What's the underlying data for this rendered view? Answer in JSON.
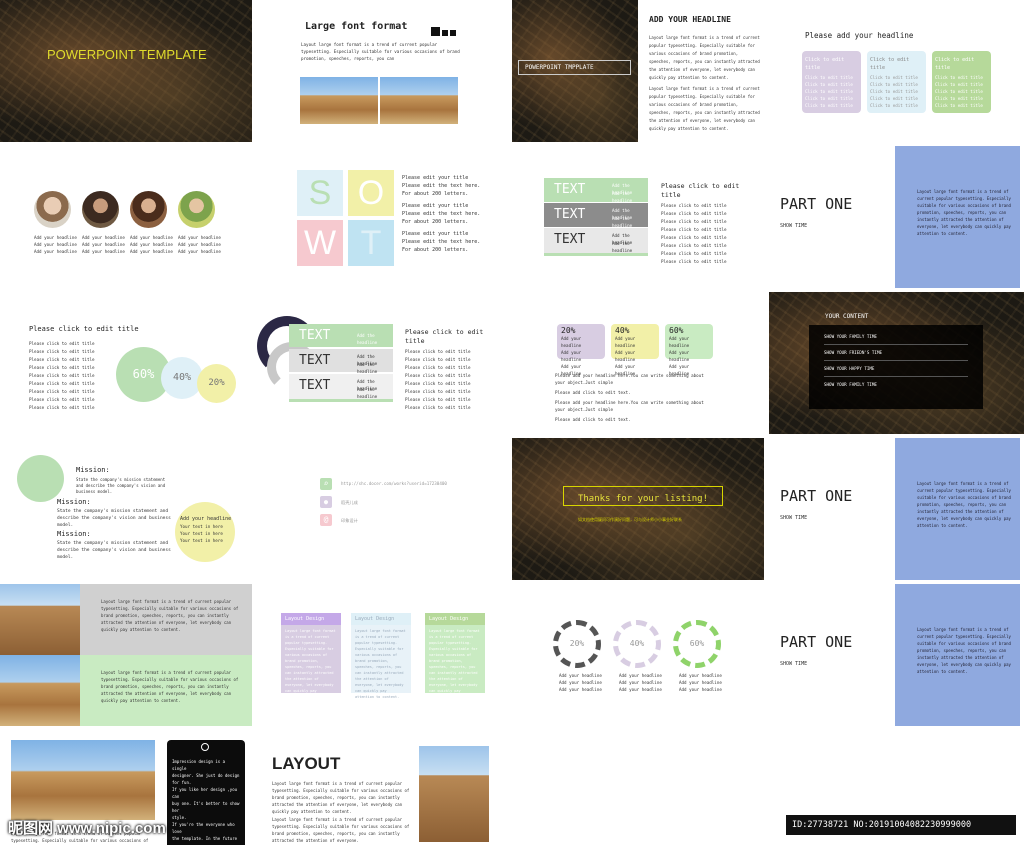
{
  "s1": {
    "title": "POWERPOINT TEMPLATE"
  },
  "s2": {
    "title": "Large font format",
    "body": "Layout large font format is a trend of current popular typesetting. Especially suitable for various occasions of brand promotion, speeches, reports, you can"
  },
  "s3": {
    "label": "POWERPOINT TMPPLATE",
    "head": "ADD YOUR HEADLINE",
    "p1": "Layout large font format is a trend of current popular typesetting. Especially suitable for various occasions of brand promotion, speeches, reports, you can instantly attracted the attention of everyone, let everybody can quickly pay attention to content.",
    "p2": "Layout large font format is a trend of current popular typesetting. Especially suitable for various occasions of brand promotion, speeches, reports, you can instantly attracted the attention of everyone, let everybody can quickly pay attention to content."
  },
  "s4": {
    "head": "Please add your headline",
    "card": "Click to edit title",
    "line": "Click to edit title"
  },
  "s5": {
    "cap1": "Add your headline",
    "cap2": "Add your headline",
    "cap3": "Add your headline"
  },
  "s6": {
    "letters": [
      "S",
      "O",
      "W",
      "T"
    ],
    "l1": "Please edit your title",
    "l2": "Please edit the text here.",
    "l3": "For about 200 letters."
  },
  "s7": {
    "bar": "TEXT",
    "item": "Add the headline",
    "head": "Please click to edit title",
    "line": "Please click to edit title"
  },
  "part": {
    "title": "PART ONE",
    "sub": "SHOW TIME",
    "body": "Layout large font format is a trend of current popular typesetting. Especially suitable for various occasions of brand promotion, speeches, reports, you can instantly attracted the attention of everyone, let everybody can quickly pay attention to content."
  },
  "s9": {
    "head": "Please click to edit title",
    "line": "Please click to edit title",
    "pcts": [
      "60%",
      "40%",
      "20%"
    ]
  },
  "s10": {
    "bar": "TEXT",
    "item": "Add the headline",
    "head": "Please click to edit title",
    "line": "Please click to edit title"
  },
  "s11": {
    "pcts": [
      "20%",
      "40%",
      "60%"
    ],
    "line": "Add your headline",
    "p1": "Please add your headline here.You can write something about your object.Just simple",
    "p2": "Please add click to edit text.",
    "p3": "Please add your headline here.You can write something about your object.Just simple",
    "p4": "Please add click to edit text."
  },
  "s12": {
    "head": "YOUR CONTENT",
    "items": [
      "SHOW YOUR FAMILY TIME",
      "SHOW YOUR FRIEDN'S TIME",
      "SHOW YOUR HAPPY TIME",
      "SHOW YOUR FAMILY TIME"
    ]
  },
  "s13": {
    "m": "Mission:",
    "mt": "State the company's mission statement and describe the company's vision and business model.",
    "bubble": "Add your headline",
    "bline": "Your text in here"
  },
  "s14": {
    "url": "http://shc.docer.com/works?userid=17230400",
    "c1": "稻壳儿成",
    "c2": "印象设计"
  },
  "s15": {
    "thanks": "Thanks for your listing!",
    "sub": "如文档使用疑问可作演好问题，可与设计师小小事业好联系"
  },
  "s17": {
    "p1": "Layout large font format is a trend of current popular typesetting. Especially suitable for various occasions of brand promotion, speeches, reports, you can instantly attracted the attention of everyone, let everybody can quickly pay attention to content.",
    "p2": "Layout large font format is a trend of current popular typesetting. Especially suitable for various occasions of brand promotion, speeches, reports, you can instantly attracted the attention of everyone, let everybody can quickly pay attention to content."
  },
  "s18": {
    "card": "Layout Design",
    "body": "Layout large font format is a trend of current popular typesetting. Especially suitable for various occasions of brand promotion, speeches, reports, you can instantly attracted the attention of everyone, let everybody can quickly pay attention to content."
  },
  "s19": {
    "pcts": [
      "20%",
      "40%",
      "60%"
    ],
    "line": "Add your headline"
  },
  "s21": {
    "lines": [
      "Impression design is a single",
      "designer. She just do design",
      "for fun.",
      "If you like her design ,you can",
      "buy one. It's better to show her",
      "style.",
      "If you're the everyone who love",
      "the template. In the future"
    ],
    "foot": "Layout large font format is a trend of current popular typesetting. Especially suitable for various occasions of brand promotion."
  },
  "s22": {
    "title": "LAYOUT",
    "p1": "Layout large font format is a trend of current popular typesetting. Especially suitable for various occasions of brand promotion, speeches, reports, you can instantly attracted the attention of everyone, let everybody can quickly pay attention to content.",
    "p2": "Layout large font format is a trend of current popular typesetting. Especially suitable for various occasions of brand promotion, speeches, reports, you can instantly attracted the attention of everyone."
  },
  "footer": {
    "brand": "昵图网 www.nipic.com",
    "id": "ID:27738721 NO:20191004082230999000"
  },
  "colors": {
    "blue": "#8fa9df",
    "green": "#b9dfb3",
    "yellow": "#f2f0a8",
    "purple": "#d8cde2",
    "lightblue": "#dff0f7",
    "gold": "#d8d500"
  }
}
